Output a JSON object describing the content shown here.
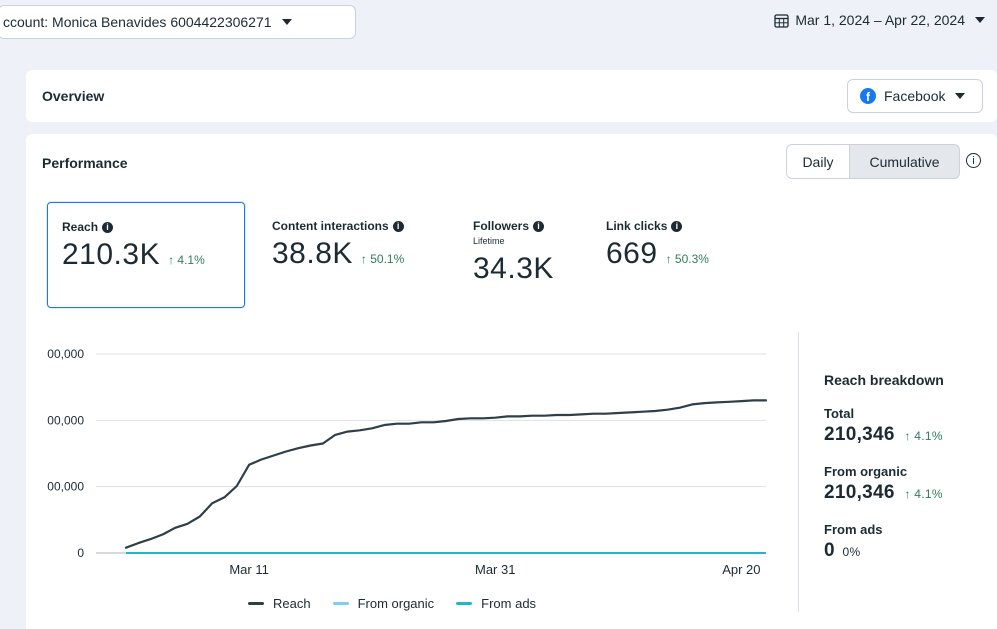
{
  "top_bar": {
    "account_label": "ccount: Monica Benavides 6004422306271",
    "date_range": "Mar 1, 2024 – Apr 22, 2024"
  },
  "overview": {
    "title": "Overview",
    "platform": "Facebook"
  },
  "performance": {
    "title": "Performance",
    "toggle": {
      "daily": "Daily",
      "cumulative": "Cumulative",
      "selected": "Cumulative"
    },
    "metrics": [
      {
        "label": "Reach",
        "sub": "",
        "value": "210.3K",
        "change": "↑ 4.1%",
        "selected": true
      },
      {
        "label": "Content interactions",
        "sub": "",
        "value": "38.8K",
        "change": "↑ 50.1%"
      },
      {
        "label": "Followers",
        "sub": "Lifetime",
        "value": "34.3K",
        "change": ""
      },
      {
        "label": "Link clicks",
        "sub": "",
        "value": "669",
        "change": "↑ 50.3%"
      }
    ]
  },
  "chart_data": {
    "type": "line",
    "y_tick_labels": [
      "00,000",
      "00,000",
      "00,000",
      "0"
    ],
    "y_tick_values": [
      300000,
      200000,
      100000,
      0
    ],
    "x_tick_labels": [
      "Mar 11",
      "Mar 31",
      "Apr 20"
    ],
    "x_tick_days": [
      10,
      30,
      50
    ],
    "x_range_days": [
      0,
      52
    ],
    "ylim": [
      0,
      300000
    ],
    "grid": true,
    "legend_position": "bottom",
    "series": [
      {
        "name": "Reach",
        "color": "#2f3f4a",
        "x": [
          0,
          1,
          2,
          3,
          4,
          5,
          6,
          7,
          8,
          9,
          10,
          11,
          12,
          13,
          14,
          15,
          16,
          17,
          18,
          19,
          20,
          21,
          22,
          23,
          24,
          25,
          26,
          27,
          28,
          29,
          30,
          31,
          32,
          33,
          34,
          35,
          36,
          37,
          38,
          39,
          40,
          41,
          42,
          43,
          44,
          45,
          46,
          47,
          48,
          49,
          50,
          51,
          52
        ],
        "values": [
          8000,
          15000,
          21000,
          28000,
          38000,
          44000,
          55000,
          75000,
          84000,
          101000,
          133000,
          141000,
          147000,
          153000,
          158000,
          162000,
          165000,
          178000,
          183000,
          185000,
          188000,
          193000,
          195000,
          195000,
          197000,
          197000,
          199000,
          202000,
          203000,
          203000,
          204000,
          206000,
          206000,
          207000,
          207000,
          208000,
          208000,
          209000,
          210000,
          210000,
          211000,
          212000,
          213000,
          214000,
          216000,
          219000,
          224000,
          226000,
          227000,
          228000,
          229000,
          230000,
          230000
        ]
      },
      {
        "name": "From organic",
        "color": "#7ad0f0",
        "values": []
      },
      {
        "name": "From ads",
        "color": "#1fb8c4",
        "x": [
          0,
          52
        ],
        "values": [
          0,
          0
        ]
      }
    ]
  },
  "breakdown": {
    "title": "Reach breakdown",
    "total_label": "Total",
    "total_value": "210,346",
    "total_change": "↑ 4.1%",
    "organic_label": "From organic",
    "organic_value": "210,346",
    "organic_change": "↑ 4.1%",
    "ads_label": "From ads",
    "ads_value": "0",
    "ads_pct": "0%"
  }
}
